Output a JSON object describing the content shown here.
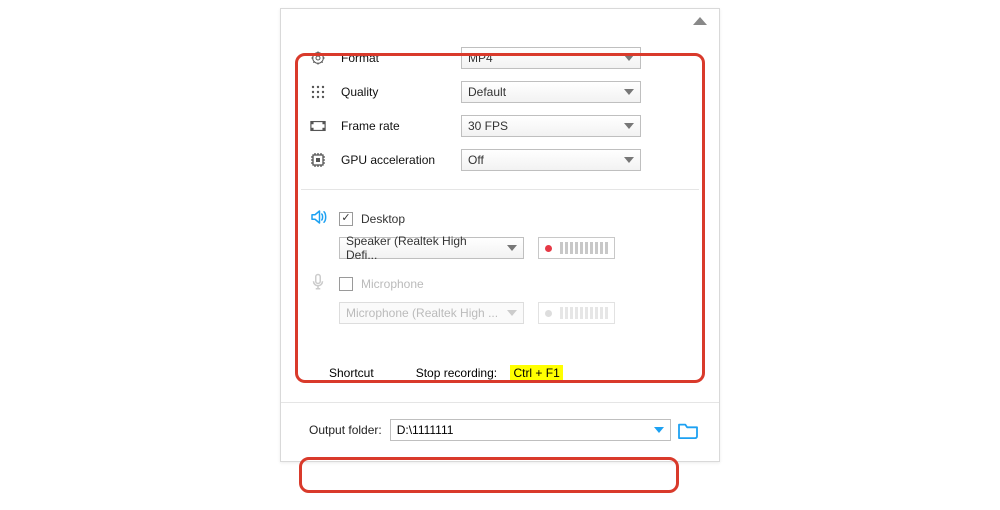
{
  "settings": {
    "format": {
      "label": "Format",
      "value": "MP4"
    },
    "quality": {
      "label": "Quality",
      "value": "Default"
    },
    "frame_rate": {
      "label": "Frame rate",
      "value": "30 FPS"
    },
    "gpu": {
      "label": "GPU acceleration",
      "value": "Off"
    }
  },
  "audio": {
    "desktop": {
      "label": "Desktop",
      "checked": true,
      "device": "Speaker (Realtek High Defi..."
    },
    "microphone": {
      "label": "Microphone",
      "checked": false,
      "device": "Microphone (Realtek High ..."
    }
  },
  "shortcut": {
    "label": "Shortcut",
    "stop_label": "Stop recording:",
    "stop_key": "Ctrl + F1"
  },
  "output": {
    "label": "Output folder:",
    "path": "D:\\1111111"
  }
}
